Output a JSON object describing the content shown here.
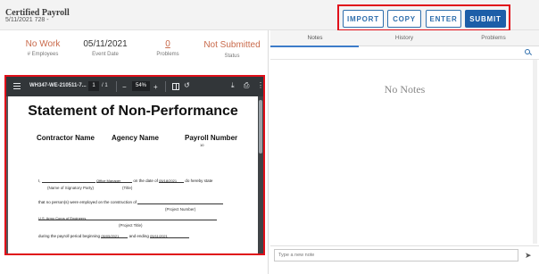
{
  "header": {
    "title": "Certified Payroll",
    "subtitle": "5/11/2021 728 -"
  },
  "actions": {
    "import": "IMPORT",
    "copy": "COPY",
    "enter": "ENTER",
    "submit": "SUBMIT"
  },
  "summary": {
    "employees_value": "No Work",
    "employees_label": "# Employees",
    "event_date_value": "05/11/2021",
    "event_date_label": "Event Date",
    "problems_value": "0",
    "problems_label": "Problems",
    "status_value": "Not Submitted",
    "status_label": "Status"
  },
  "pdf": {
    "filename": "WH347-WE-210511-7...",
    "page_current": "1",
    "page_total": "/ 1",
    "zoom": "54%",
    "title": "Statement of Non-Performance",
    "col_contractor": "Contractor Name",
    "col_agency": "Agency Name",
    "col_payroll": "Payroll Number",
    "payroll_number_value": "10",
    "line1_prefix": "I,",
    "line1_title": "Office Manager",
    "line1_middle": "on the date of",
    "line1_date": "05/18/2021",
    "line1_suffix": "do hereby state",
    "cap_signatory": "(Name of Signatory Party)",
    "cap_title": "(Title)",
    "line2": "that no person(s) were employed on the construction of",
    "cap_project_number": "(Project Number)",
    "agency_value": "U.S. Army Corps of Engineers",
    "cap_project_title": "(Project Title)",
    "line3_prefix": "during the payroll period beginning",
    "line3_begin": "05/05/2021",
    "line3_mid": "and ending",
    "line3_end": "05/11/2021"
  },
  "notes_panel": {
    "tabs": [
      "Notes",
      "History",
      "Problems"
    ],
    "empty_text": "No Notes",
    "input_placeholder": "Type a new note"
  },
  "icons": {
    "search": "search-icon",
    "send": "send-icon",
    "menu": "menu-icon",
    "download": "download-icon",
    "print": "print-icon"
  },
  "colors": {
    "accent": "#1d5ea8",
    "highlight_box": "#e0101a",
    "summary_value": "#c96a4b"
  }
}
